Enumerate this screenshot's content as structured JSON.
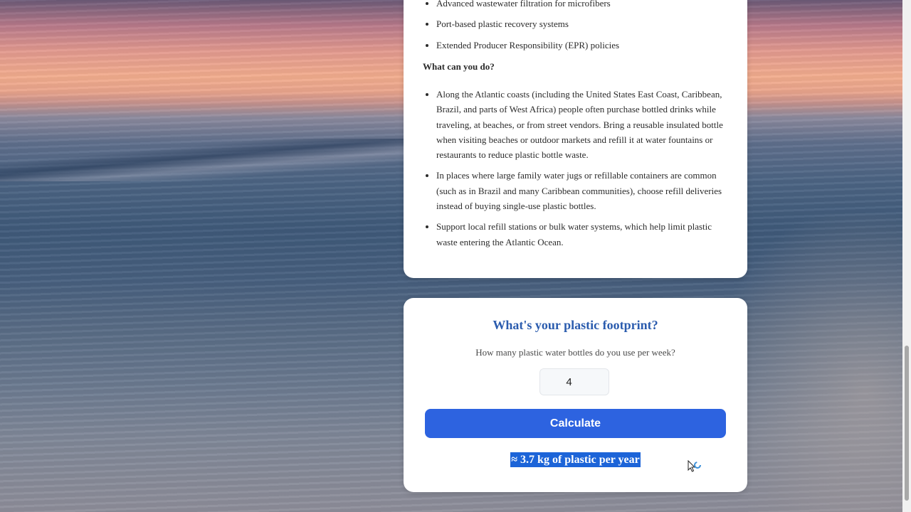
{
  "solutions_list": [
    "Advanced wastewater filtration for microfibers",
    "Port-based plastic recovery systems",
    "Extended Producer Responsibility (EPR) policies"
  ],
  "what_can_you_do": {
    "heading": "What can you do?",
    "items": [
      "Along the Atlantic coasts (including the United States East Coast, Caribbean, Brazil, and parts of West Africa) people often purchase bottled drinks while traveling, at beaches, or from street vendors. Bring a reusable insulated bottle when visiting beaches or outdoor markets and refill it at water fountains or restaurants to reduce plastic bottle waste.",
      "In places where large family water jugs or refillable containers are common (such as in Brazil and many Caribbean communities), choose refill deliveries instead of buying single-use plastic bottles.",
      "Support local refill stations or bulk water systems, which help limit plastic waste entering the Atlantic Ocean."
    ]
  },
  "footprint": {
    "title": "What's your plastic footprint?",
    "question": "How many plastic water bottles do you use per week?",
    "input_value": "4",
    "button_label": "Calculate",
    "result": "≈ 3.7 kg of plastic per year"
  },
  "colors": {
    "accent": "#2d63e0",
    "title_blue": "#2b5cae",
    "selection": "#1c64d8"
  },
  "icons": {
    "cursor": "loading-pointer-icon"
  }
}
